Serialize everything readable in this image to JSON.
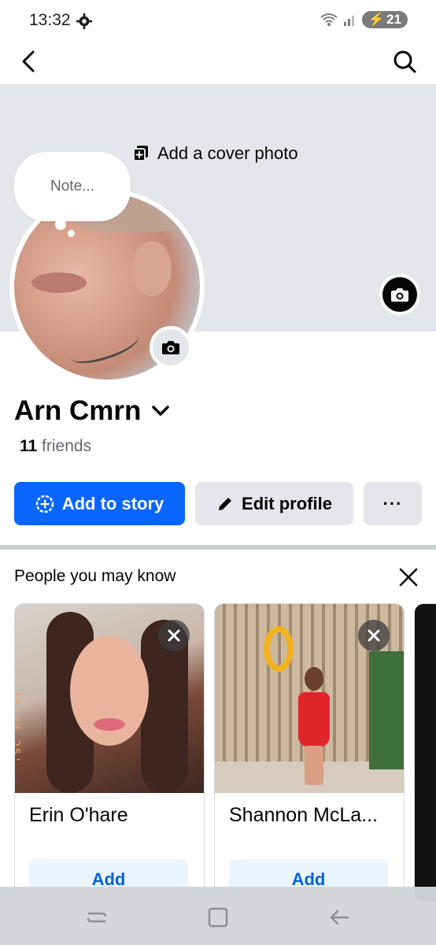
{
  "status_bar": {
    "time": "13:32",
    "battery": "21"
  },
  "top_nav": {
    "back_icon": "back-arrow-icon",
    "search_icon": "search-icon"
  },
  "cover": {
    "add_cover_label": "Add a cover photo",
    "note_placeholder": "Note..."
  },
  "profile": {
    "name": "Arn Cmrn",
    "friends_count": "11",
    "friends_label": "friends"
  },
  "actions": {
    "add_story_label": "Add to story",
    "edit_profile_label": "Edit profile",
    "more_label": "···"
  },
  "pymk": {
    "title": "People you may know",
    "cards": [
      {
        "name": "Erin O'hare",
        "add_label": "Add",
        "photo_stamp": "16:34  25'"
      },
      {
        "name": "Shannon McLa...",
        "add_label": "Add"
      }
    ]
  },
  "colors": {
    "primary": "#0866ff",
    "secondary_button": "#e4e6eb",
    "cover_bg": "#e4e6eb",
    "add_button_bg": "#ebf5ff",
    "add_button_text": "#0064d1"
  }
}
